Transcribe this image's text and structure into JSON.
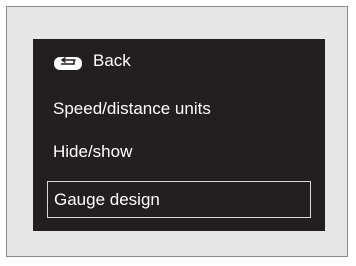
{
  "menu": {
    "back_label": "Back",
    "items": [
      {
        "label": "Speed/distance units"
      },
      {
        "label": "Hide/show"
      },
      {
        "label": "Gauge design"
      }
    ],
    "selected": "Gauge design"
  },
  "icons": {
    "back": "return-arrow-icon"
  },
  "colors": {
    "screen_background": "#231f20",
    "frame_background": "#e6e6e6",
    "text": "#ffffff",
    "selection_border": "#d8d8d8"
  }
}
